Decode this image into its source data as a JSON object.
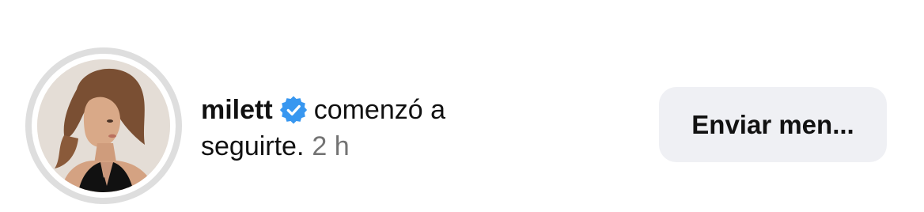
{
  "notification": {
    "username": "milett",
    "action_line1": "comenzó a",
    "action_line2": "seguirte.",
    "time": "2 h",
    "verified_icon": "verified-badge-icon",
    "avatar_icon": "profile-photo"
  },
  "button": {
    "label": "Enviar men..."
  },
  "colors": {
    "verified": "#3897f0",
    "muted_text": "#737373",
    "button_bg": "#eff0f4",
    "ring": "#dedede"
  }
}
